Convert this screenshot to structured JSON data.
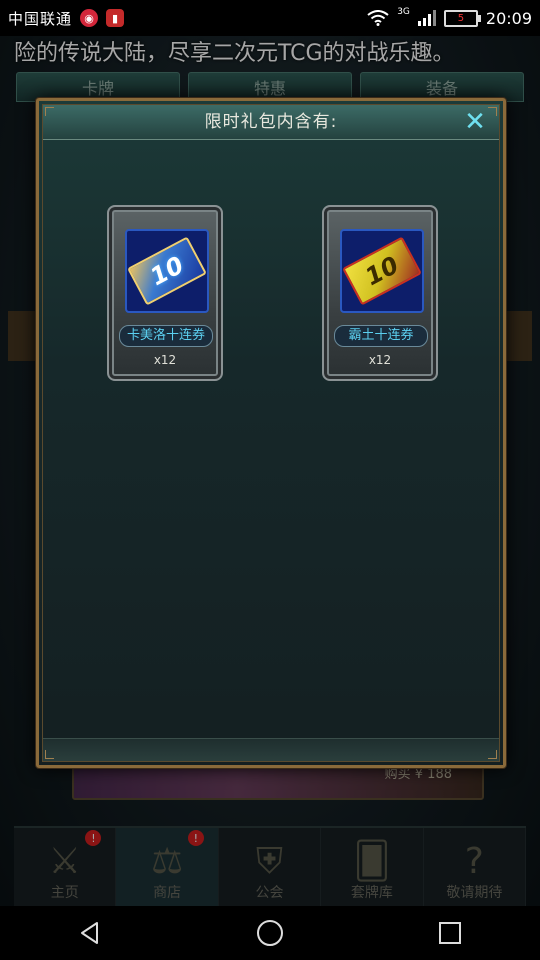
{
  "status_bar": {
    "carrier": "中国联通",
    "network": "3G",
    "battery_level": "5",
    "time": "20:09"
  },
  "marquee": {
    "text": "险的传说大陆，尽享二次元TCG的对战乐趣。"
  },
  "shop_tabs": [
    "卡牌",
    "特惠",
    "装备"
  ],
  "buy_strip": {
    "label": "购买 ¥ 188"
  },
  "bottom_nav": {
    "items": [
      {
        "label": "主页",
        "icon": "sword-icon",
        "badge": "!",
        "active": false
      },
      {
        "label": "商店",
        "icon": "scales-icon",
        "badge": "!",
        "active": true
      },
      {
        "label": "公会",
        "icon": "guild-crest-icon",
        "badge": "",
        "active": false
      },
      {
        "label": "套牌库",
        "icon": "cards-icon",
        "badge": "",
        "active": false
      },
      {
        "label": "敬请期待",
        "icon": "question-icon",
        "badge": "",
        "active": false
      }
    ]
  },
  "modal": {
    "title": "限时礼包内含有:",
    "close_icon": "close-icon",
    "items": [
      {
        "name": "卡美洛十连券",
        "count": "x12",
        "ticket_number": "10",
        "icon": "ticket-blue-icon"
      },
      {
        "name": "霸土十连券",
        "count": "x12",
        "ticket_number": "10",
        "icon": "ticket-gold-icon"
      }
    ]
  },
  "colors": {
    "modal_border": "#8a6a3a",
    "close_accent": "#6fe0f0",
    "item_name_text": "#5cd0f0",
    "badge": "#d42020"
  }
}
